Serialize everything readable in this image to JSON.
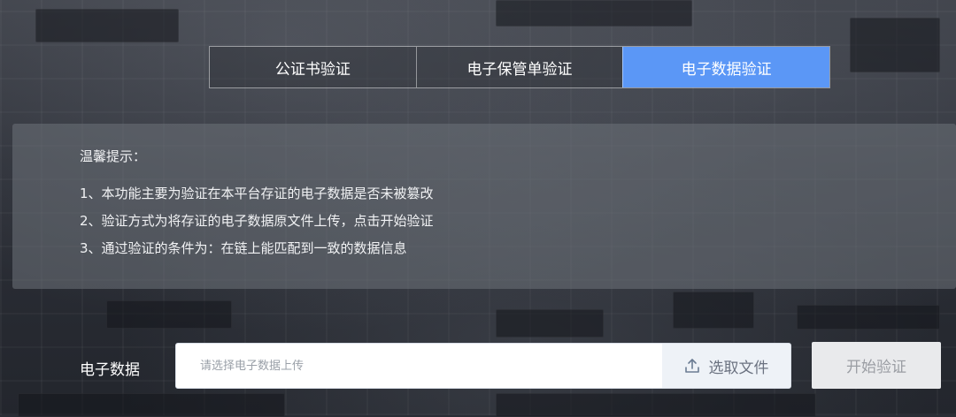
{
  "tabs": [
    {
      "label": "公证书验证",
      "active": false
    },
    {
      "label": "电子保管单验证",
      "active": false
    },
    {
      "label": "电子数据验证",
      "active": true
    }
  ],
  "notice": {
    "title": "温馨提示：",
    "items": [
      "1、本功能主要为验证在本平台存证的电子数据是否未被篡改",
      "2、验证方式为将存证的电子数据原文件上传，点击开始验证",
      "3、通过验证的条件为：在链上能匹配到一致的数据信息"
    ]
  },
  "upload": {
    "label": "电子数据",
    "placeholder": "请选择电子数据上传",
    "value": "",
    "select_button": "选取文件",
    "select_icon": "upload-icon",
    "start_button": "开始验证"
  },
  "colors": {
    "accent": "#5b97f6",
    "start_button_bg": "#e9eaec",
    "start_button_text": "#9a9da3"
  }
}
